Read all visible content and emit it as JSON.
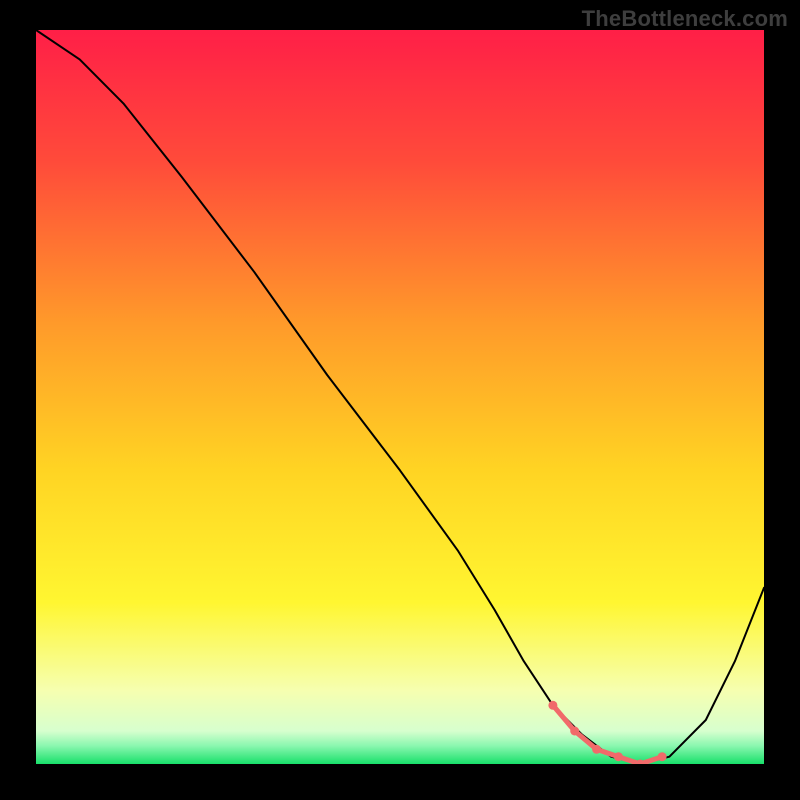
{
  "watermark": "TheBottleneck.com",
  "chart_data": {
    "type": "line",
    "title": "",
    "xlabel": "",
    "ylabel": "",
    "xlim": [
      0,
      100
    ],
    "ylim": [
      0,
      100
    ],
    "grid": false,
    "legend": false,
    "gradient_stops": [
      {
        "offset": 0.0,
        "color": "#ff1f47"
      },
      {
        "offset": 0.18,
        "color": "#ff4b3a"
      },
      {
        "offset": 0.4,
        "color": "#ff9a2a"
      },
      {
        "offset": 0.6,
        "color": "#ffd423"
      },
      {
        "offset": 0.78,
        "color": "#fff631"
      },
      {
        "offset": 0.9,
        "color": "#f6ffb0"
      },
      {
        "offset": 0.955,
        "color": "#d7ffce"
      },
      {
        "offset": 0.975,
        "color": "#8bf7b0"
      },
      {
        "offset": 1.0,
        "color": "#18e06a"
      }
    ],
    "series": [
      {
        "name": "bottleneck-curve",
        "color": "#000000",
        "stroke_width": 2,
        "x": [
          0,
          6,
          12,
          20,
          30,
          40,
          50,
          58,
          63,
          67,
          71,
          75,
          79,
          83,
          87,
          92,
          96,
          100
        ],
        "values": [
          100,
          96,
          90,
          80,
          67,
          53,
          40,
          29,
          21,
          14,
          8,
          4,
          1,
          0,
          1,
          6,
          14,
          24
        ]
      }
    ],
    "highlight_band": {
      "name": "optimal-range",
      "color": "#f16a6a",
      "dot_radius": 4.5,
      "x": [
        71,
        74,
        77,
        80,
        83,
        86
      ],
      "values": [
        8,
        4.5,
        2,
        1,
        0,
        1
      ]
    }
  }
}
